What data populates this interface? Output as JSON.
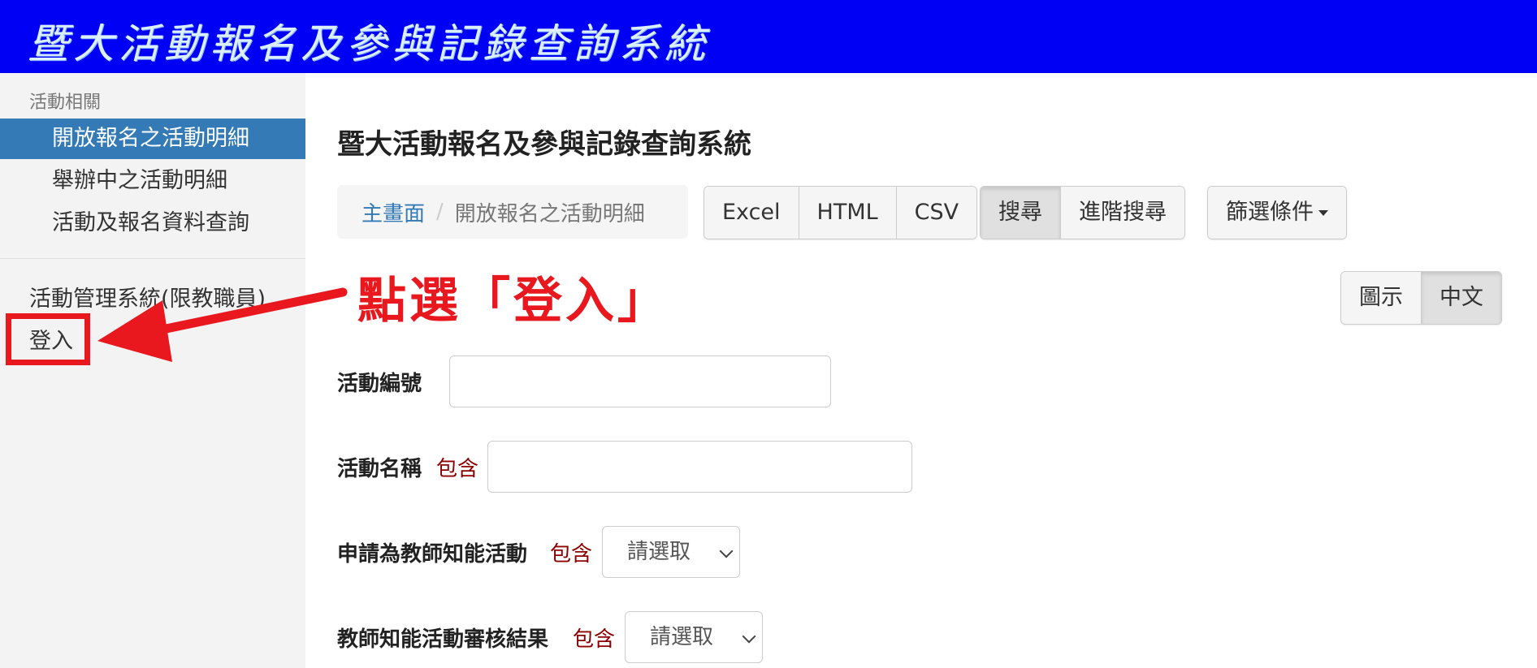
{
  "banner": {
    "title": "暨大活動報名及參與記錄查詢系統"
  },
  "sidebar": {
    "section_header": "活動相關",
    "items": [
      {
        "label": "開放報名之活動明細",
        "active": true
      },
      {
        "label": "舉辦中之活動明細",
        "active": false
      },
      {
        "label": "活動及報名資料查詢",
        "active": false
      }
    ],
    "management_label": "活動管理系統(限教職員)",
    "login_label": "登入"
  },
  "annotation": {
    "text": "點選「登入」",
    "color": "#e8181e"
  },
  "main": {
    "page_title": "暨大活動報名及參與記錄查詢系統",
    "breadcrumb": {
      "home": "主畫面",
      "separator": "/",
      "current": "開放報名之活動明細"
    },
    "export_buttons": [
      "Excel",
      "HTML",
      "CSV"
    ],
    "search_buttons": {
      "search": "搜尋",
      "advanced": "進階搜尋"
    },
    "filter_button": "篩選條件",
    "view_toggle": {
      "chart": "圖示",
      "chinese": "中文"
    },
    "fields": [
      {
        "label": "活動編號",
        "contains": ""
      },
      {
        "label": "活動名稱",
        "contains": "包含"
      },
      {
        "label": "申請為教師知能活動",
        "contains": "包含",
        "select": "請選取"
      },
      {
        "label": "教師知能活動審核結果",
        "contains": "包含",
        "select": "請選取"
      }
    ]
  },
  "colors": {
    "banner": "#0000f5",
    "active_nav": "#337ab7",
    "link": "#337ab7",
    "contains": "#8b0000"
  }
}
